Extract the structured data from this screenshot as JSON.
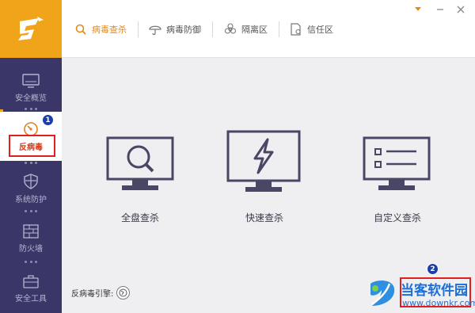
{
  "sidebar": {
    "items": [
      {
        "label": "安全概览",
        "icon": "monitor-icon"
      },
      {
        "label": "反病毒",
        "icon": "speedometer-icon",
        "active": true
      },
      {
        "label": "系统防护",
        "icon": "shield-icon"
      },
      {
        "label": "防火墙",
        "icon": "firewall-icon"
      },
      {
        "label": "安全工具",
        "icon": "toolbox-icon"
      }
    ]
  },
  "topbar": {
    "tabs": [
      {
        "label": "病毒查杀",
        "icon": "search-icon",
        "active": true
      },
      {
        "label": "病毒防御",
        "icon": "umbrella-icon"
      },
      {
        "label": "隔离区",
        "icon": "biohazard-icon"
      },
      {
        "label": "信任区",
        "icon": "trust-file-icon"
      }
    ]
  },
  "main": {
    "scan_options": [
      {
        "label": "全盘查杀",
        "icon": "magnifier-monitor-icon"
      },
      {
        "label": "快速查杀",
        "icon": "lightning-monitor-icon"
      },
      {
        "label": "自定义查杀",
        "icon": "checklist-monitor-icon"
      }
    ],
    "engine_label": "反病毒引擎:"
  },
  "annotations": {
    "badge_1": "1",
    "badge_2": "2"
  },
  "watermark": {
    "text": "当客软件园",
    "url": "www.downkr.com"
  },
  "colors": {
    "sidebar": "#3a3768",
    "accent": "#f0a41a",
    "active_tab": "#e58a1a",
    "icon_stroke": "#4a4766",
    "annotation_red": "#e02020",
    "badge_blue": "#1b3ea8"
  }
}
